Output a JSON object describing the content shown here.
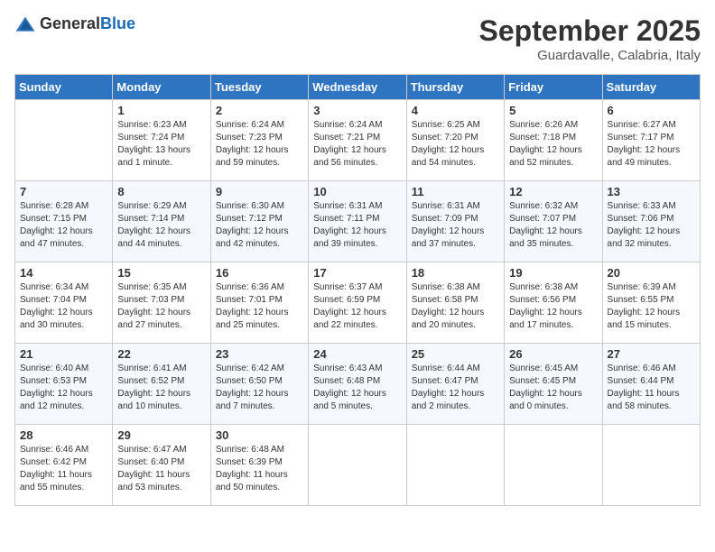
{
  "header": {
    "logo_general": "General",
    "logo_blue": "Blue",
    "month_year": "September 2025",
    "location": "Guardavalle, Calabria, Italy"
  },
  "days_of_week": [
    "Sunday",
    "Monday",
    "Tuesday",
    "Wednesday",
    "Thursday",
    "Friday",
    "Saturday"
  ],
  "weeks": [
    [
      {
        "day": "",
        "text": ""
      },
      {
        "day": "1",
        "text": "Sunrise: 6:23 AM\nSunset: 7:24 PM\nDaylight: 13 hours\nand 1 minute."
      },
      {
        "day": "2",
        "text": "Sunrise: 6:24 AM\nSunset: 7:23 PM\nDaylight: 12 hours\nand 59 minutes."
      },
      {
        "day": "3",
        "text": "Sunrise: 6:24 AM\nSunset: 7:21 PM\nDaylight: 12 hours\nand 56 minutes."
      },
      {
        "day": "4",
        "text": "Sunrise: 6:25 AM\nSunset: 7:20 PM\nDaylight: 12 hours\nand 54 minutes."
      },
      {
        "day": "5",
        "text": "Sunrise: 6:26 AM\nSunset: 7:18 PM\nDaylight: 12 hours\nand 52 minutes."
      },
      {
        "day": "6",
        "text": "Sunrise: 6:27 AM\nSunset: 7:17 PM\nDaylight: 12 hours\nand 49 minutes."
      }
    ],
    [
      {
        "day": "7",
        "text": "Sunrise: 6:28 AM\nSunset: 7:15 PM\nDaylight: 12 hours\nand 47 minutes."
      },
      {
        "day": "8",
        "text": "Sunrise: 6:29 AM\nSunset: 7:14 PM\nDaylight: 12 hours\nand 44 minutes."
      },
      {
        "day": "9",
        "text": "Sunrise: 6:30 AM\nSunset: 7:12 PM\nDaylight: 12 hours\nand 42 minutes."
      },
      {
        "day": "10",
        "text": "Sunrise: 6:31 AM\nSunset: 7:11 PM\nDaylight: 12 hours\nand 39 minutes."
      },
      {
        "day": "11",
        "text": "Sunrise: 6:31 AM\nSunset: 7:09 PM\nDaylight: 12 hours\nand 37 minutes."
      },
      {
        "day": "12",
        "text": "Sunrise: 6:32 AM\nSunset: 7:07 PM\nDaylight: 12 hours\nand 35 minutes."
      },
      {
        "day": "13",
        "text": "Sunrise: 6:33 AM\nSunset: 7:06 PM\nDaylight: 12 hours\nand 32 minutes."
      }
    ],
    [
      {
        "day": "14",
        "text": "Sunrise: 6:34 AM\nSunset: 7:04 PM\nDaylight: 12 hours\nand 30 minutes."
      },
      {
        "day": "15",
        "text": "Sunrise: 6:35 AM\nSunset: 7:03 PM\nDaylight: 12 hours\nand 27 minutes."
      },
      {
        "day": "16",
        "text": "Sunrise: 6:36 AM\nSunset: 7:01 PM\nDaylight: 12 hours\nand 25 minutes."
      },
      {
        "day": "17",
        "text": "Sunrise: 6:37 AM\nSunset: 6:59 PM\nDaylight: 12 hours\nand 22 minutes."
      },
      {
        "day": "18",
        "text": "Sunrise: 6:38 AM\nSunset: 6:58 PM\nDaylight: 12 hours\nand 20 minutes."
      },
      {
        "day": "19",
        "text": "Sunrise: 6:38 AM\nSunset: 6:56 PM\nDaylight: 12 hours\nand 17 minutes."
      },
      {
        "day": "20",
        "text": "Sunrise: 6:39 AM\nSunset: 6:55 PM\nDaylight: 12 hours\nand 15 minutes."
      }
    ],
    [
      {
        "day": "21",
        "text": "Sunrise: 6:40 AM\nSunset: 6:53 PM\nDaylight: 12 hours\nand 12 minutes."
      },
      {
        "day": "22",
        "text": "Sunrise: 6:41 AM\nSunset: 6:52 PM\nDaylight: 12 hours\nand 10 minutes."
      },
      {
        "day": "23",
        "text": "Sunrise: 6:42 AM\nSunset: 6:50 PM\nDaylight: 12 hours\nand 7 minutes."
      },
      {
        "day": "24",
        "text": "Sunrise: 6:43 AM\nSunset: 6:48 PM\nDaylight: 12 hours\nand 5 minutes."
      },
      {
        "day": "25",
        "text": "Sunrise: 6:44 AM\nSunset: 6:47 PM\nDaylight: 12 hours\nand 2 minutes."
      },
      {
        "day": "26",
        "text": "Sunrise: 6:45 AM\nSunset: 6:45 PM\nDaylight: 12 hours\nand 0 minutes."
      },
      {
        "day": "27",
        "text": "Sunrise: 6:46 AM\nSunset: 6:44 PM\nDaylight: 11 hours\nand 58 minutes."
      }
    ],
    [
      {
        "day": "28",
        "text": "Sunrise: 6:46 AM\nSunset: 6:42 PM\nDaylight: 11 hours\nand 55 minutes."
      },
      {
        "day": "29",
        "text": "Sunrise: 6:47 AM\nSunset: 6:40 PM\nDaylight: 11 hours\nand 53 minutes."
      },
      {
        "day": "30",
        "text": "Sunrise: 6:48 AM\nSunset: 6:39 PM\nDaylight: 11 hours\nand 50 minutes."
      },
      {
        "day": "",
        "text": ""
      },
      {
        "day": "",
        "text": ""
      },
      {
        "day": "",
        "text": ""
      },
      {
        "day": "",
        "text": ""
      }
    ]
  ]
}
